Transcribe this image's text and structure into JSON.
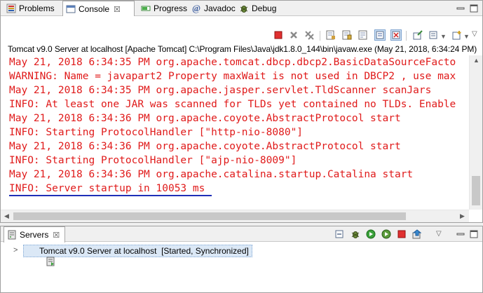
{
  "top_tabs": [
    {
      "label": "Problems",
      "icon": "problems-icon"
    },
    {
      "label": "Console",
      "icon": "console-icon",
      "active": true,
      "close": "☒"
    },
    {
      "label": "Progress",
      "icon": "progress-icon"
    },
    {
      "label": "Javadoc",
      "icon": "javadoc-icon"
    },
    {
      "label": "Debug",
      "icon": "debug-icon"
    }
  ],
  "console_description": "Tomcat v9.0 Server at localhost [Apache Tomcat] C:\\Program Files\\Java\\jdk1.8.0_144\\bin\\javaw.exe (May 21, 2018, 6:34:24 PM)",
  "console_lines": [
    "May 21, 2018 6:34:35 PM org.apache.tomcat.dbcp.dbcp2.BasicDataSourceFacto",
    "WARNING: Name = javapart2 Property maxWait is not used in DBCP2 , use max",
    "May 21, 2018 6:34:35 PM org.apache.jasper.servlet.TldScanner scanJars",
    "INFO: At least one JAR was scanned for TLDs yet contained no TLDs. Enable",
    "May 21, 2018 6:34:36 PM org.apache.coyote.AbstractProtocol start",
    "INFO: Starting ProtocolHandler [\"http-nio-8080\"]",
    "May 21, 2018 6:34:36 PM org.apache.coyote.AbstractProtocol start",
    "INFO: Starting ProtocolHandler [\"ajp-nio-8009\"]",
    "May 21, 2018 6:34:36 PM org.apache.catalina.startup.Catalina start",
    "INFO: Server startup in 10053 ms"
  ],
  "servers_tab": {
    "label": "Servers",
    "icon": "servers-icon",
    "close": "☒"
  },
  "server_entry": {
    "name": "Tomcat v9.0 Server at localhost",
    "status": "  [Started, Synchronized]"
  },
  "colors": {
    "console_text": "#e01a1a",
    "underline": "#1e2fb8",
    "selection": "#dbe8f6"
  }
}
